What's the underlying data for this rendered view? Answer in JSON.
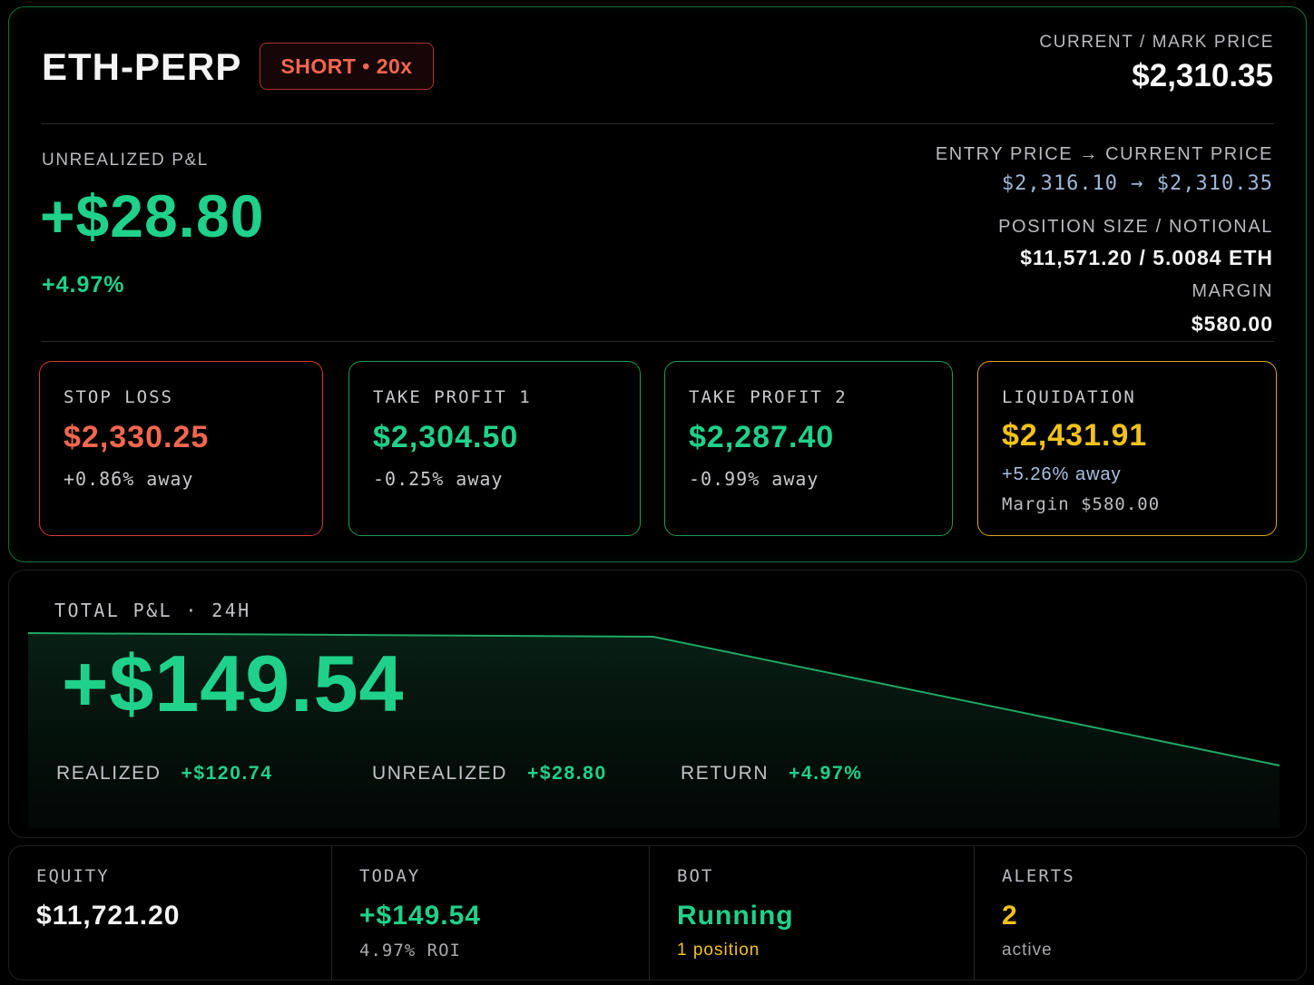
{
  "position": {
    "symbol": "ETH-PERP",
    "side_badge": "SHORT • 20x",
    "mark_label": "CURRENT / MARK PRICE",
    "mark_price": "$2,310.35",
    "unrealized_label": "UNREALIZED P&L",
    "unrealized_value": "+$28.80",
    "unrealized_pct": "+4.97%",
    "entry_current_label": "ENTRY PRICE → CURRENT PRICE",
    "entry_current_value": "$2,316.10 → $2,310.35",
    "size_label": "POSITION SIZE / NOTIONAL",
    "size_value": "$11,571.20 / 5.0084 ETH",
    "margin_label": "MARGIN",
    "margin_value": "$580.00"
  },
  "levels": {
    "stop_loss": {
      "label": "STOP LOSS",
      "price": "$2,330.25",
      "away": "+0.86% away"
    },
    "take_profit_1": {
      "label": "TAKE PROFIT 1",
      "price": "$2,304.50",
      "away": "-0.25% away"
    },
    "take_profit_2": {
      "label": "TAKE PROFIT 2",
      "price": "$2,287.40",
      "away": "-0.99% away"
    },
    "liquidation": {
      "label": "LIQUIDATION",
      "price": "$2,431.91",
      "away": "+5.26% away",
      "extra": "Margin $580.00"
    }
  },
  "total_pnl": {
    "label": "TOTAL P&L · 24H",
    "value": "+$149.54",
    "realized_label": "REALIZED",
    "realized_value": "+$120.74",
    "unrealized_label": "UNREALIZED",
    "unrealized_value": "+$28.80",
    "return_label": "RETURN",
    "return_value": "+4.97%"
  },
  "stats": {
    "equity": {
      "label": "EQUITY",
      "value": "$11,721.20"
    },
    "today": {
      "label": "TODAY",
      "value": "+$149.54",
      "sub": "4.97% ROI"
    },
    "bot": {
      "label": "BOT",
      "value": "Running",
      "sub": "1 position"
    },
    "alerts": {
      "label": "ALERTS",
      "value": "2",
      "sub": "active"
    }
  },
  "colors": {
    "profit": "#1fd18a",
    "loss": "#f2674f",
    "warning": "#f2c21b",
    "card_border": "#1d6b3a"
  }
}
